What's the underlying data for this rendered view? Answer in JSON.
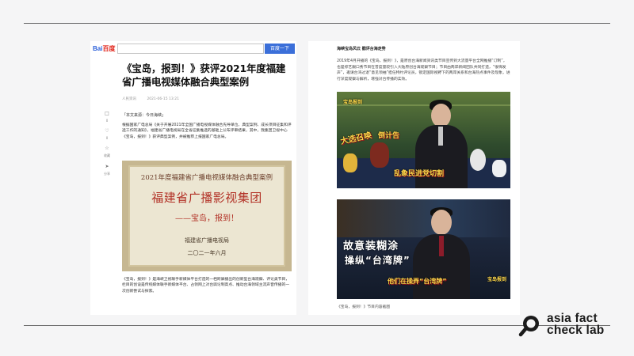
{
  "left": {
    "logo": {
      "text": "Bai",
      "suffix": "百度"
    },
    "search_button": "百度一下",
    "title": "《宝岛，报到！》获评2021年度福建省广播电视媒体融合典型案例",
    "meta": {
      "source": "人民资讯",
      "date": "2021-06-15 13:21"
    },
    "side_actions": [
      {
        "icon": "comment-icon",
        "label": "0"
      },
      {
        "icon": "like-icon",
        "label": "0"
      },
      {
        "icon": "collect-icon",
        "label": "收藏"
      },
      {
        "icon": "share-icon",
        "label": "分享"
      }
    ],
    "source_line": "「本文来源：今日海峡」",
    "paragraph1": "根据国家广电总局《关于开展2021年全国广播电视媒体融合先导单位、典型案例、成长项目征集和评选工作的通知》，福建省广播电视局在全省征集推选的基础上公布评审结果，其中，我集团卫视中心《宝岛，报到！》获评典型案例，并被推荐上报国家广电总局。",
    "plaque": {
      "line1": "2021年度福建省广播电视媒体融合典型案例",
      "line2": "福建省广播影视集团",
      "line3": "——宝岛，报到！",
      "line4": "福建省广播电视局",
      "line5": "二〇二一年六月"
    },
    "paragraph2": "《宝岛，报到！》是海峡卫视联手新媒体平台打造的一档跨屏播出的创新型台海观察、评论类节目，栏目的创设是传统媒体联手新媒体平台、占领网上对台舆论制高点、推动台海领域主流声音传播的一次创新尝试与探索。"
  },
  "right": {
    "heading": "海峡宝岛风云 戳评台海走势",
    "paragraph": "2019年4月开播的《宝岛，报到！》，是原创台海新闻资讯类节目宣传到大流量平台全网推播“订制”，也是综艺跟口秀节目在普度量较引入大陆原创台海观察节目；节目由两岸新闻团队共同打造，“很嗨发声”，邀请台湾过退“意见领袖”担任特约评论员，锁定国际视野下的两岸关系和台海热点事件及现象，进行深度观察与解析，增强对台传播的实效。",
    "shot1": {
      "badge": "宝岛报到",
      "tag1": "大选召唤",
      "tag2": "倒计告",
      "tag3": "乱象民进党切割"
    },
    "shot2": {
      "badge": "宝岛报到",
      "headline1": "故意装糊涂",
      "headline2": "操纵“台湾牌”",
      "banner": "他们在操弄“台湾牌”"
    },
    "caption": "《宝岛，报到！》节目内容截图"
  },
  "brand": {
    "line1": "asia fact",
    "line2": "check lab"
  },
  "colors": {
    "baidu_blue": "#2b5fd9",
    "plaque_red": "#b23126",
    "rule": "#6b6b6b",
    "caption_yellow": "#ffd84a"
  }
}
